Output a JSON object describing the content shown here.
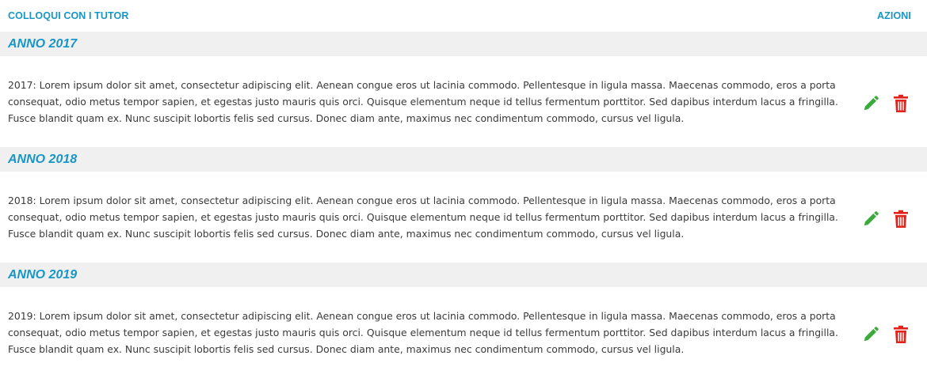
{
  "header": {
    "title": "COLLOQUI CON I TUTOR",
    "actions_label": "AZIONI"
  },
  "colors": {
    "accent": "#1a96c6",
    "edit": "#3daa3d",
    "delete": "#e2231a",
    "row_bg": "#f0f0f0"
  },
  "entries": [
    {
      "year_label": "ANNO 2017",
      "text": "2017: Lorem ipsum dolor sit amet, consectetur adipiscing elit. Aenean congue eros ut lacinia commodo. Pellentesque in ligula massa. Maecenas commodo, eros a porta consequat, odio metus tempor sapien, et egestas justo mauris quis orci. Quisque elementum neque id tellus fermentum porttitor. Sed dapibus interdum lacus a fringilla. Fusce blandit quam ex. Nunc suscipit lobortis felis sed cursus. Donec diam ante, maximus nec condimentum commodo, cursus vel ligula.",
      "edit_icon": "pencil-icon",
      "delete_icon": "trash-icon"
    },
    {
      "year_label": "ANNO 2018",
      "text": "2018: Lorem ipsum dolor sit amet, consectetur adipiscing elit. Aenean congue eros ut lacinia commodo. Pellentesque in ligula massa. Maecenas commodo, eros a porta consequat, odio metus tempor sapien, et egestas justo mauris quis orci. Quisque elementum neque id tellus fermentum porttitor. Sed dapibus interdum lacus a fringilla. Fusce blandit quam ex. Nunc suscipit lobortis felis sed cursus. Donec diam ante, maximus nec condimentum commodo, cursus vel ligula.",
      "edit_icon": "pencil-icon",
      "delete_icon": "trash-icon"
    },
    {
      "year_label": "ANNO 2019",
      "text": "2019: Lorem ipsum dolor sit amet, consectetur adipiscing elit. Aenean congue eros ut lacinia commodo. Pellentesque in ligula massa. Maecenas commodo, eros a porta consequat, odio metus tempor sapien, et egestas justo mauris quis orci. Quisque elementum neque id tellus fermentum porttitor. Sed dapibus interdum lacus a fringilla. Fusce blandit quam ex. Nunc suscipit lobortis felis sed cursus. Donec diam ante, maximus nec condimentum commodo, cursus vel ligula.",
      "edit_icon": "pencil-icon",
      "delete_icon": "trash-icon"
    }
  ]
}
